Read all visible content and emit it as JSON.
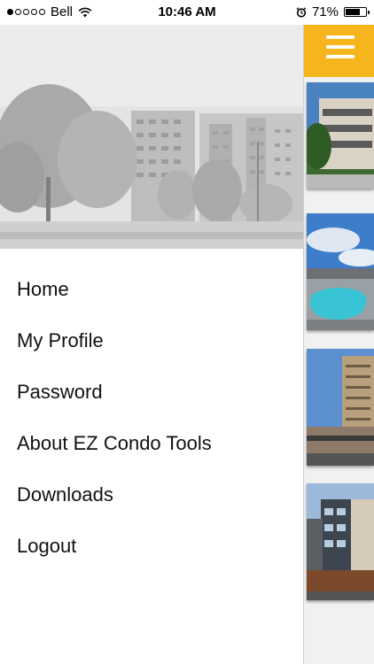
{
  "status_bar": {
    "carrier": "Bell",
    "time": "10:46 AM",
    "battery_percent": "71%",
    "battery_level": 0.71,
    "signal_dots_filled": 1,
    "signal_dots_total": 5,
    "icons": [
      "wifi-icon",
      "alarm-icon",
      "battery-icon"
    ]
  },
  "drawer": {
    "hero_image": "condo-buildings-photo",
    "menu": [
      {
        "label": "Home"
      },
      {
        "label": "My Profile"
      },
      {
        "label": "Password"
      },
      {
        "label": "About EZ Condo Tools"
      },
      {
        "label": "Downloads"
      },
      {
        "label": "Logout"
      }
    ]
  },
  "main": {
    "accent_color": "#f6b51c",
    "menu_icon": "hamburger-icon",
    "cards": [
      {
        "image": "condo-building-photo"
      },
      {
        "image": "pool-photo"
      },
      {
        "image": "high-rise-photo"
      },
      {
        "image": "modern-building-photo"
      }
    ]
  }
}
